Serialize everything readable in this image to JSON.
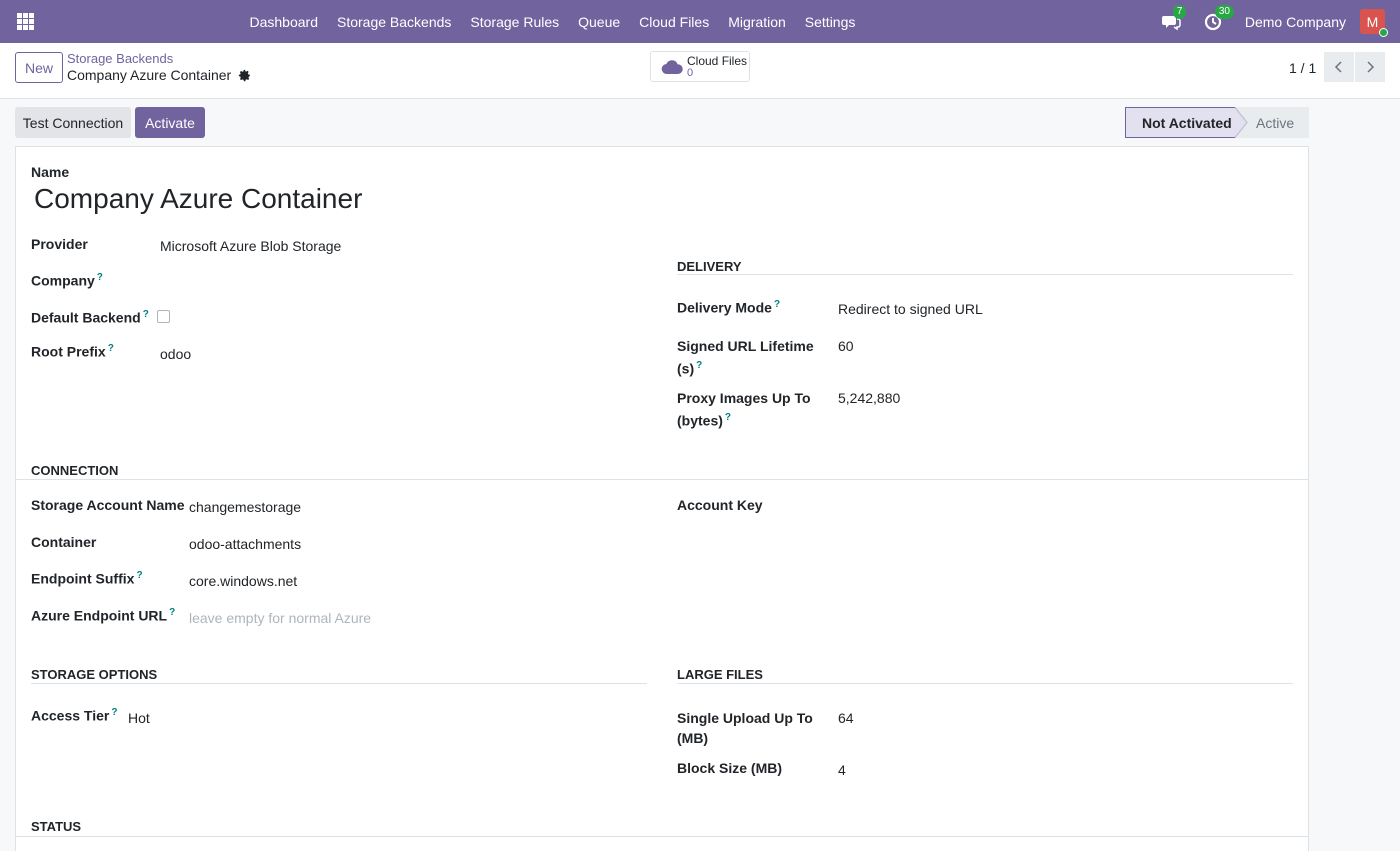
{
  "nav": {
    "menu": [
      "Dashboard",
      "Storage Backends",
      "Storage Rules",
      "Queue",
      "Cloud Files",
      "Migration",
      "Settings"
    ],
    "messages_count": "7",
    "activities_count": "30",
    "company": "Demo Company",
    "avatar_letter": "M"
  },
  "control_panel": {
    "new_label": "New",
    "breadcrumb_parent": "Storage Backends",
    "breadcrumb_current": "Company Azure Container",
    "smart_button": {
      "label": "Cloud Files",
      "count": "0"
    },
    "pager": "1 / 1"
  },
  "actions": {
    "test_connection": "Test Connection",
    "activate": "Activate"
  },
  "status": {
    "stages": [
      "Not Activated",
      "Active"
    ],
    "current": "Not Activated"
  },
  "form": {
    "name_label": "Name",
    "name_value": "Company Azure Container",
    "provider_label": "Provider",
    "provider_value": "Microsoft Azure Blob Storage",
    "company_label": "Company",
    "default_backend_label": "Default Backend",
    "root_prefix_label": "Root Prefix",
    "root_prefix_value": "odoo",
    "delivery": {
      "section": "DELIVERY",
      "mode_label": "Delivery Mode",
      "mode_value": "Redirect to signed URL",
      "lifetime_label_1": "Signed URL Lifetime",
      "lifetime_label_2": "(s)",
      "lifetime_value": "60",
      "proxy_label_1": "Proxy Images Up To",
      "proxy_label_2": "(bytes)",
      "proxy_value": "5,242,880"
    },
    "connection": {
      "section": "CONNECTION",
      "account_name_label": "Storage Account Name",
      "account_name_value": "changemestorage",
      "container_label": "Container",
      "container_value": "odoo-attachments",
      "endpoint_suffix_label": "Endpoint Suffix",
      "endpoint_suffix_value": "core.windows.net",
      "endpoint_url_label": "Azure Endpoint URL",
      "endpoint_url_placeholder": "leave empty for normal Azure",
      "account_key_label": "Account Key"
    },
    "storage_options": {
      "section": "STORAGE OPTIONS",
      "access_tier_label": "Access Tier",
      "access_tier_value": "Hot"
    },
    "large_files": {
      "section": "LARGE FILES",
      "single_upload_label_1": "Single Upload Up To",
      "single_upload_label_2": "(MB)",
      "single_upload_value": "64",
      "block_size_label": "Block Size (MB)",
      "block_size_value": "4"
    },
    "status_section": "STATUS"
  },
  "colors": {
    "brand": "#71639e",
    "badge": "#28a745",
    "help": "#017e84"
  }
}
